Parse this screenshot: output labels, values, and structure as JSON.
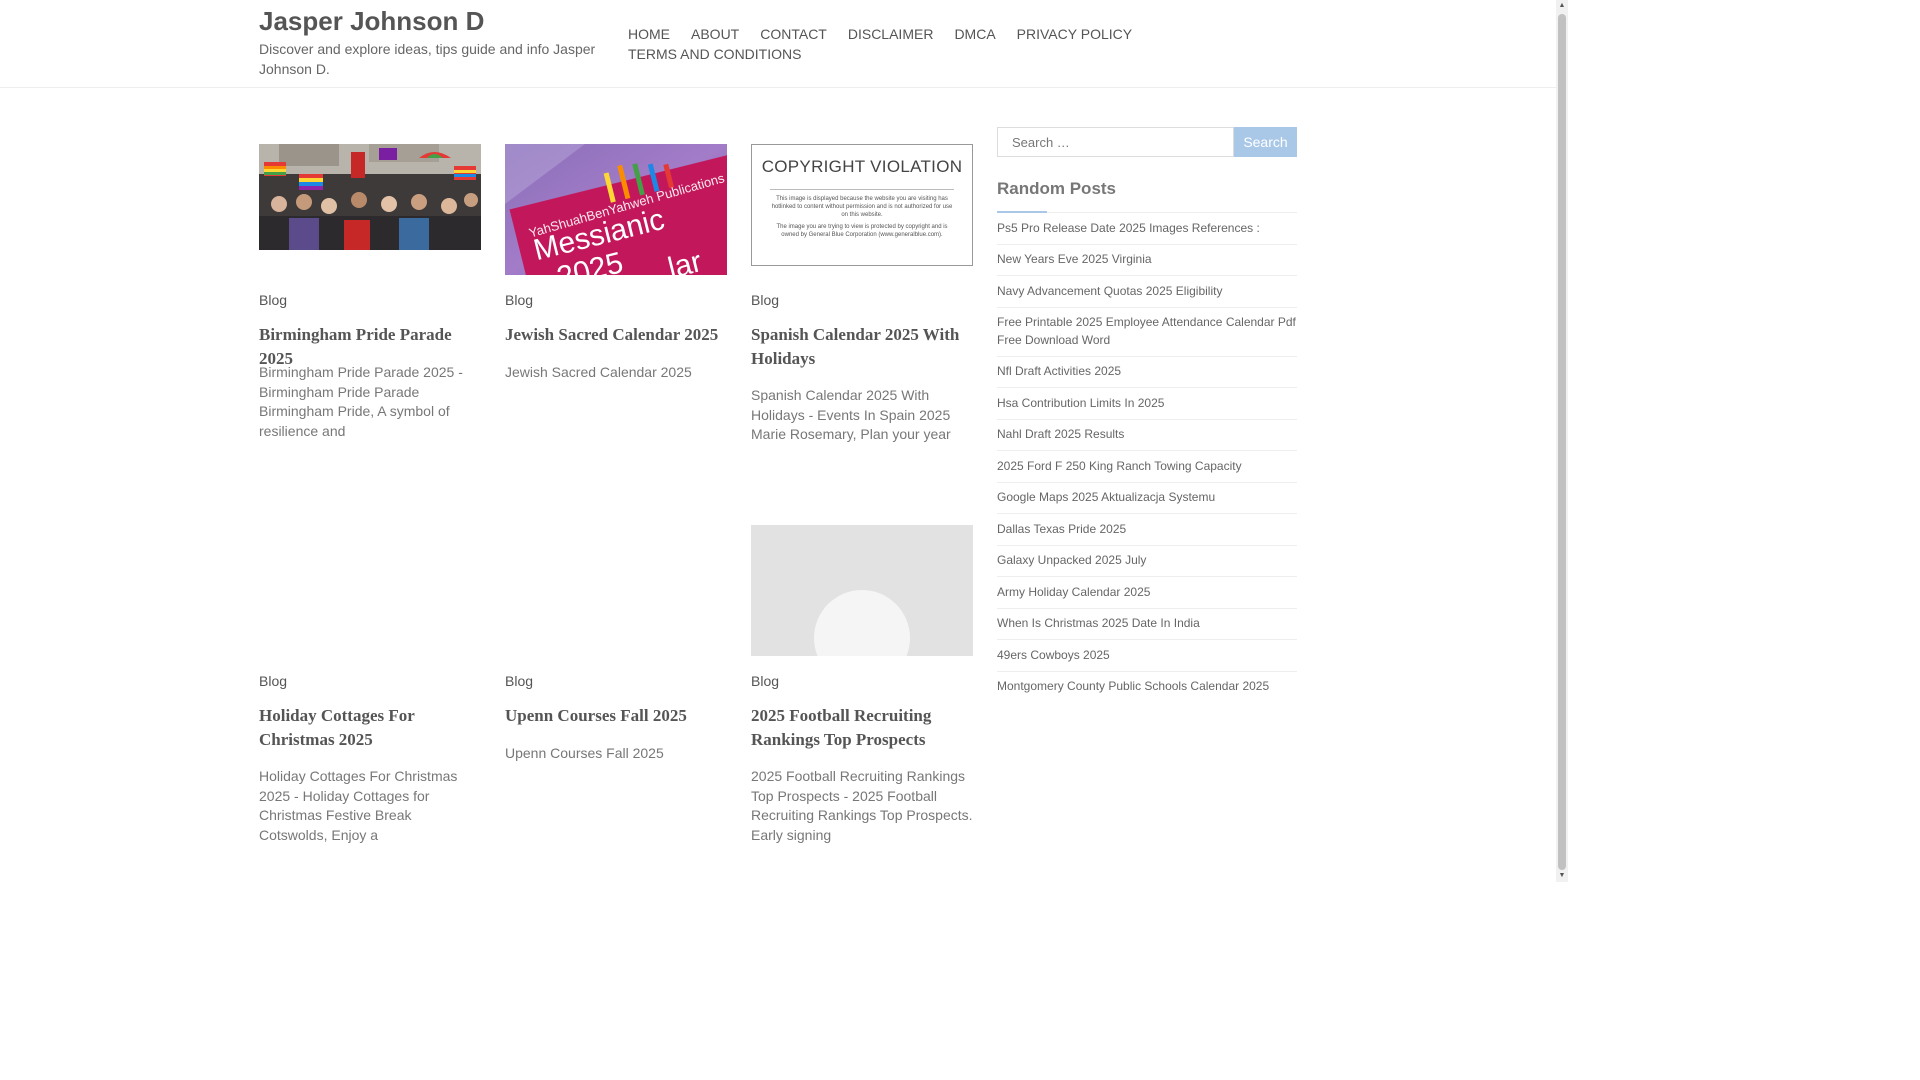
{
  "site": {
    "title": "Jasper Johnson D",
    "description": "Discover and explore ideas, tips guide and info Jasper Johnson D."
  },
  "nav": {
    "items": [
      "HOME",
      "ABOUT",
      "CONTACT",
      "DISCLAIMER",
      "DMCA",
      "PRIVACY POLICY",
      "TERMS AND CONDITIONS"
    ]
  },
  "posts": [
    {
      "category": "Blog",
      "title": "Birmingham Pride Parade 2025",
      "excerpt": "Birmingham Pride Parade 2025 - Birmingham Pride Parade Birmingham Pride, A symbol of resilience and",
      "image": "pride-parade-photo"
    },
    {
      "category": "Blog",
      "title": "Jewish Sacred Calendar 2025",
      "excerpt": "Jewish Sacred Calendar 2025",
      "image": "messianic-calendar-photo",
      "image_text": {
        "publisher": "YahShuahBenYahweh Publications",
        "line1": "Messianic",
        "line2": "2025",
        "line3": "lar"
      }
    },
    {
      "category": "Blog",
      "title": "Spanish Calendar 2025 With Holidays",
      "excerpt": "Spanish Calendar 2025 With Holidays - Events In Spain 2025 Marie Rosemary, Plan your year",
      "image": "copyright-violation-notice",
      "image_text": {
        "heading": "COPYRIGHT VIOLATION",
        "body1": "This image is displayed because the website you are visiting has hotlinked to content without permission and is not authorized for use on this website.",
        "body2": "The image you are trying to view is protected by copyright and is owned by General Blue Corporation (www.generalblue.com)."
      }
    },
    {
      "category": "Blog",
      "title": "Holiday Cottages For Christmas 2025",
      "excerpt": "Holiday Cottages For Christmas 2025 - Holiday Cottages for Christmas Festive Break Cotswolds, Enjoy a",
      "image": "none"
    },
    {
      "category": "Blog",
      "title": "Upenn Courses Fall 2025",
      "excerpt": "Upenn Courses Fall 2025",
      "image": "none"
    },
    {
      "category": "Blog",
      "title": "2025 Football Recruiting Rankings Top Prospects",
      "excerpt": "2025 Football Recruiting Rankings Top Prospects - 2025 Football Recruiting Rankings Top Prospects. Early signing",
      "image": "placeholder-avatar"
    }
  ],
  "search": {
    "placeholder": "Search …",
    "button_label": "Search"
  },
  "sidebar": {
    "widget_title": "Random Posts",
    "random_posts": [
      "Ps5 Pro Release Date 2025 Images References :",
      "New Years Eve 2025 Virginia",
      "Navy Advancement Quotas 2025 Eligibility",
      "Free Printable 2025 Employee Attendance Calendar Pdf Free Download Word",
      "Nfl Draft Activities 2025",
      "Hsa Contribution Limits In 2025",
      "Nahl Draft 2025 Results",
      "2025 Ford F 250 King Ranch Towing Capacity",
      "Google Maps 2025 Aktualizacja Systemu",
      "Dallas Texas Pride 2025",
      "Galaxy Unpacked 2025 July",
      "Army Holiday Calendar 2025",
      "When Is Christmas 2025 Date In India",
      "49ers Cowboys 2025",
      "Montgomery County Public Schools Calendar 2025"
    ]
  },
  "colors": {
    "accent": "#a9c8e8",
    "text": "#555555",
    "border": "#eeeeee"
  }
}
